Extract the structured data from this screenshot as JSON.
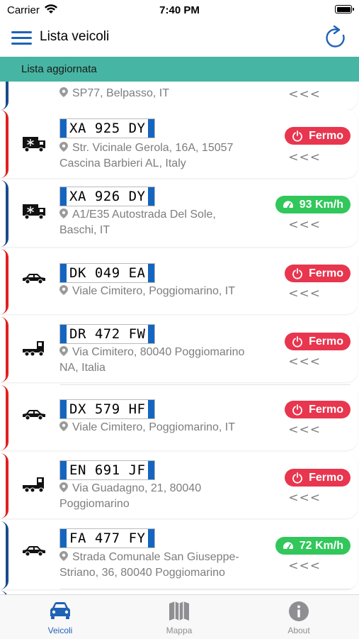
{
  "status_bar": {
    "carrier": "Carrier",
    "time": "7:40 PM"
  },
  "header": {
    "title": "Lista veicoli"
  },
  "banner": {
    "text": "Lista aggiornata"
  },
  "top_item": {
    "address": "SP77, Belpasso, IT",
    "chevron": "<<<"
  },
  "vehicles": [
    {
      "plate": "XA 925 DY",
      "address_line1": "Str. Vicinale Gerola, 16A, 15057",
      "address_line2": "Cascina Barbieri AL, Italy",
      "status": "Fermo",
      "status_type": "stop",
      "vehicle_icon": "refrigerated-truck-icon",
      "accent": "#e02020",
      "chevron": "<<<"
    },
    {
      "plate": "XA 926 DY",
      "address_line1": "A1/E35 Autostrada Del Sole,",
      "address_line2": "Baschi, IT",
      "status": "93 Km/h",
      "status_type": "move",
      "vehicle_icon": "refrigerated-truck-icon",
      "accent": "#1a4a8a",
      "chevron": "<<<"
    },
    {
      "plate": "DK 049 EA",
      "address_line1": "Viale Cimitero, Poggiomarino, IT",
      "address_line2": "",
      "status": "Fermo",
      "status_type": "stop",
      "vehicle_icon": "car-icon",
      "accent": "#e02020",
      "chevron": "<<<"
    },
    {
      "plate": "DR 472 FW",
      "address_line1": "Via Cimitero, 80040 Poggiomarino",
      "address_line2": "NA, Italia",
      "status": "Fermo",
      "status_type": "stop",
      "vehicle_icon": "tractor-truck-icon",
      "accent": "#e02020",
      "chevron": "<<<"
    },
    {
      "plate": "DX 579 HF",
      "address_line1": "Viale Cimitero, Poggiomarino, IT",
      "address_line2": "",
      "status": "Fermo",
      "status_type": "stop",
      "vehicle_icon": "car-icon",
      "accent": "#e02020",
      "chevron": "<<<"
    },
    {
      "plate": "EN 691 JF",
      "address_line1": "Via Guadagno, 21, 80040",
      "address_line2": "Poggiomarino",
      "status": "Fermo",
      "status_type": "stop",
      "vehicle_icon": "tractor-truck-icon",
      "accent": "#e02020",
      "chevron": "<<<"
    },
    {
      "plate": "FA 477 FY",
      "address_line1": "Strada Comunale San Giuseppe-",
      "address_line2": "Striano, 36, 80040 Poggiomarino",
      "status": "72 Km/h",
      "status_type": "move",
      "vehicle_icon": "car-icon",
      "accent": "#1a4a8a",
      "chevron": "<<<"
    }
  ],
  "tabs": [
    {
      "label": "Veicoli",
      "icon": "car-icon",
      "active": true,
      "color": "#1f62b6"
    },
    {
      "label": "Mappa",
      "icon": "map-icon",
      "active": false,
      "color": "#8e8e93"
    },
    {
      "label": "About",
      "icon": "info-icon",
      "active": false,
      "color": "#8e8e93"
    }
  ],
  "colors": {
    "accent": "#1f62b6",
    "banner": "#47b5a3",
    "stop": "#e8364f",
    "move": "#31c75b"
  }
}
